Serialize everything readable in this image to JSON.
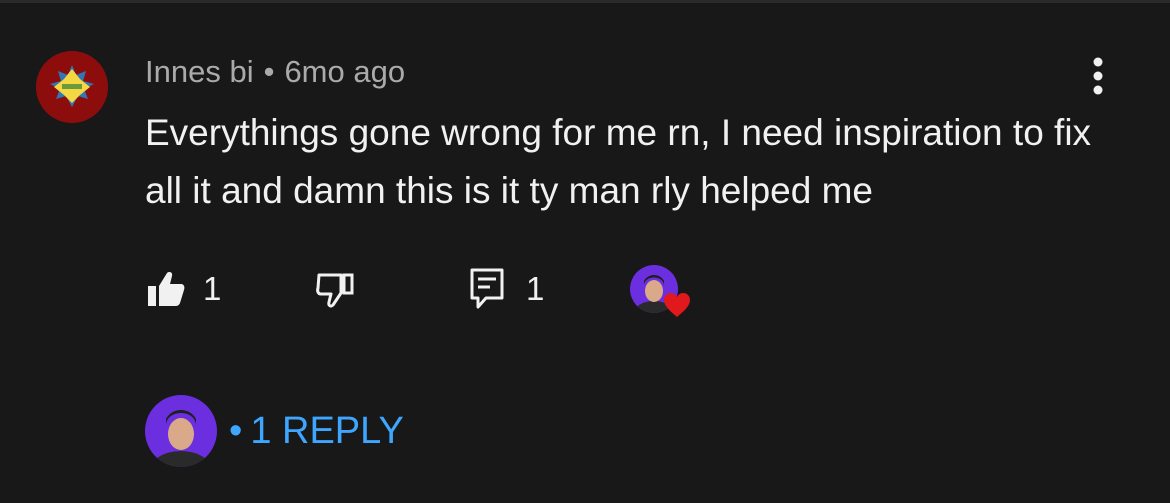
{
  "comment": {
    "author": "Innes bi",
    "separator": "•",
    "age": "6mo ago",
    "text": "Everythings gone wrong for me rn, I need inspiration to fix all it and damn this is it ty man rly helped me",
    "avatar_icon": "custom-avatar-icon"
  },
  "actions": {
    "like_count": "1",
    "reply_count": "1",
    "like_icon": "thumbs-up-icon",
    "dislike_icon": "thumbs-down-icon",
    "reply_icon": "comment-icon",
    "heart_icon": "creator-heart-icon"
  },
  "replies": {
    "dot": "•",
    "label": "1 REPLY"
  },
  "colors": {
    "background": "#181818",
    "text_primary": "#f1f1f1",
    "text_secondary": "#aaaaaa",
    "link": "#3ea6ff",
    "heart": "#e1191d",
    "avatar_ring": "#8d0d0d"
  }
}
